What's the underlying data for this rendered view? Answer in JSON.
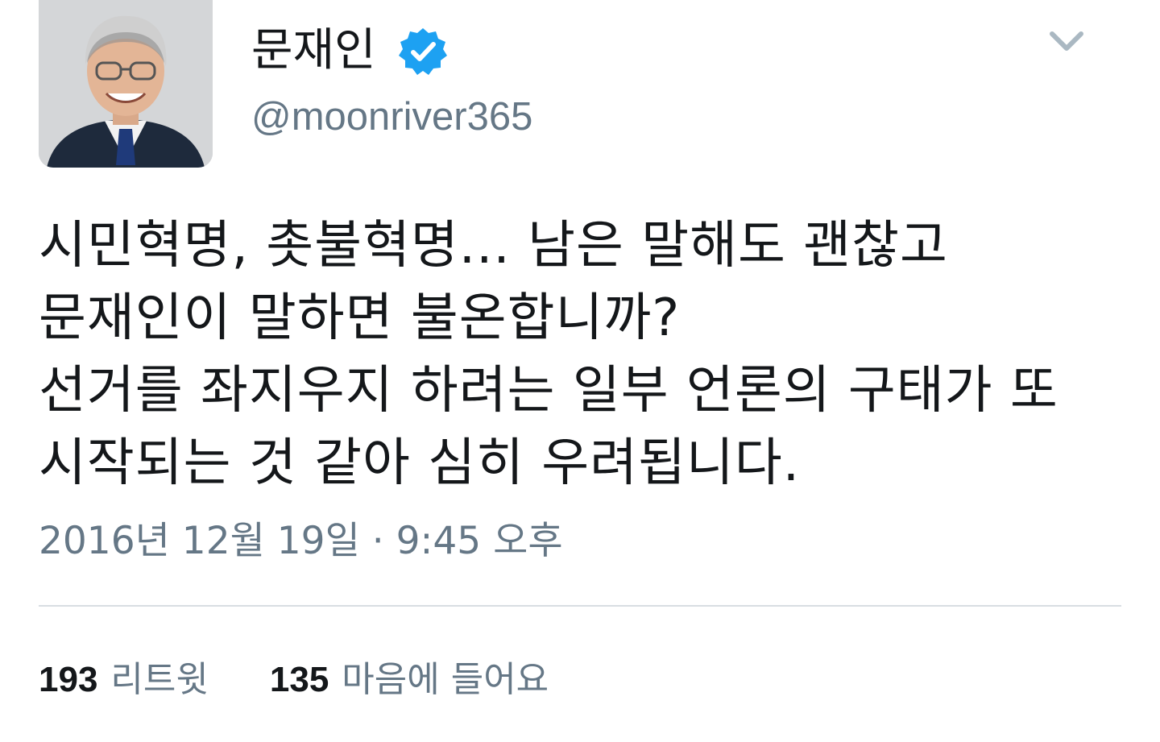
{
  "profile": {
    "display_name": "문재인",
    "handle": "@moonriver365",
    "verified_icon": "verified-badge-icon",
    "avatar_icon": "avatar"
  },
  "menu": {
    "icon": "chevron-down-icon"
  },
  "tweet": {
    "lines": [
      "시민혁명, 촛불혁명... 남은 말해도 괜찮고",
      "문재인이 말하면 불온합니까?",
      "선거를 좌지우지 하려는 일부 언론의 구태가 또",
      "시작되는 것 같아 심히 우려됩니다."
    ],
    "timestamp": "2016년 12월 19일 · 9:45 오후"
  },
  "stats": {
    "retweets_count": "193",
    "retweets_label": "리트윗",
    "likes_count": "135",
    "likes_label": "마음에 들어요"
  },
  "colors": {
    "text": "#14171a",
    "secondary": "#657786",
    "verified": "#1da1f2",
    "divider": "#d8dde2"
  }
}
